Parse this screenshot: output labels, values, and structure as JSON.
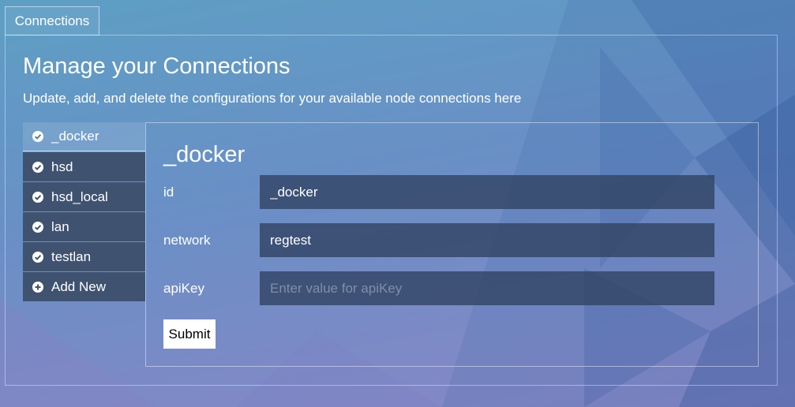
{
  "tab": {
    "label": "Connections"
  },
  "header": {
    "title": "Manage your Connections",
    "subtitle": "Update, add, and delete the configurations for your available node connections here"
  },
  "connections": [
    {
      "label": "_docker",
      "icon": "check-circle-icon",
      "selected": true
    },
    {
      "label": "hsd",
      "icon": "check-circle-icon",
      "selected": false
    },
    {
      "label": "hsd_local",
      "icon": "check-circle-icon",
      "selected": false
    },
    {
      "label": "lan",
      "icon": "check-circle-icon",
      "selected": false
    },
    {
      "label": "testlan",
      "icon": "check-circle-icon",
      "selected": false
    }
  ],
  "add_new": {
    "label": "Add New",
    "icon": "plus-circle-icon"
  },
  "form": {
    "title": "_docker",
    "fields": [
      {
        "label": "id",
        "value": "_docker",
        "placeholder": ""
      },
      {
        "label": "network",
        "value": "regtest",
        "placeholder": ""
      },
      {
        "label": "apiKey",
        "value": "",
        "placeholder": "Enter value for apiKey"
      }
    ],
    "submit_label": "Submit"
  },
  "colors": {
    "list_item_bg": "#3f5370",
    "input_bg": "#324464",
    "active_underline": "#bfe8f5"
  }
}
